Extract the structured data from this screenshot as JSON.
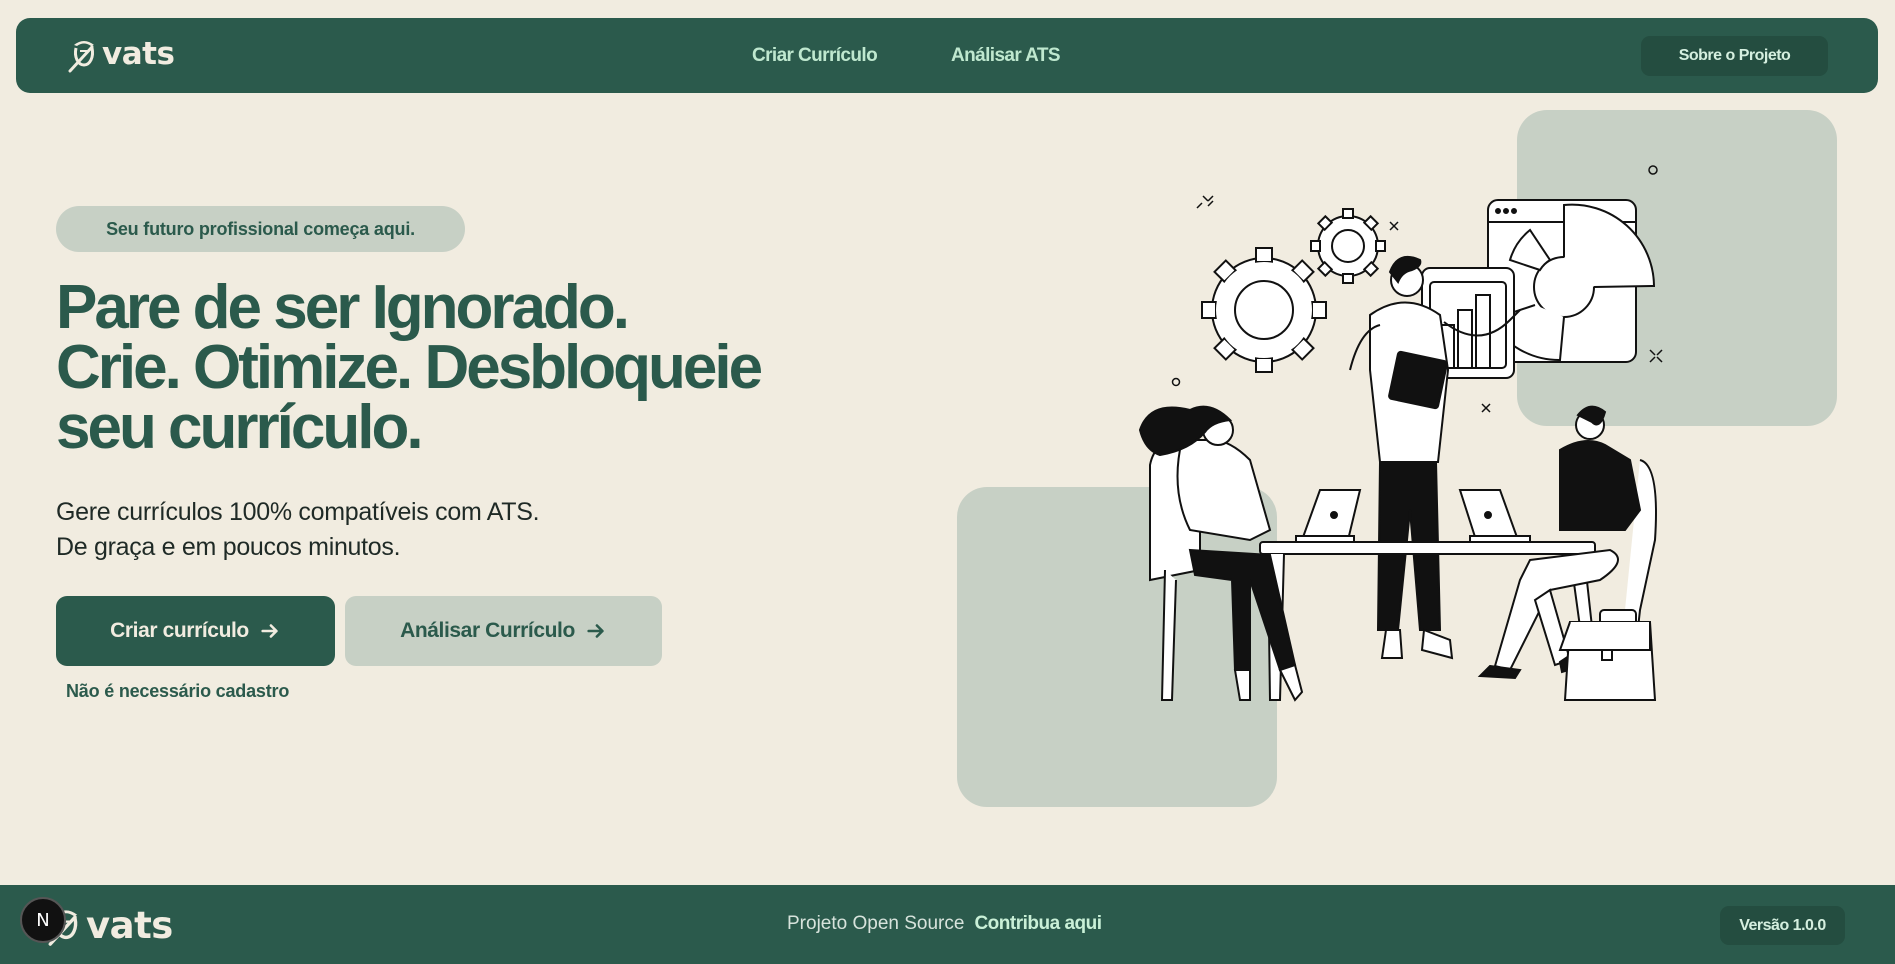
{
  "header": {
    "logo_text": "vats",
    "nav": [
      {
        "label": "Criar Currículo"
      },
      {
        "label": "Análisar ATS"
      }
    ],
    "about_label": "Sobre o Projeto"
  },
  "hero": {
    "badge": "Seu futuro profissional começa aqui.",
    "headline": [
      "Pare de ser Ignorado.",
      "Crie. Otimize. Desbloqueie",
      "seu currículo."
    ],
    "subtitle": [
      "Gere currículos 100% compatíveis com ATS.",
      "De graça e em poucos minutos."
    ],
    "primary_button": "Criar currículo",
    "secondary_button": "Análisar Currículo",
    "note": "Não é necessário cadastro"
  },
  "footer": {
    "logo_text": "vats",
    "next_badge": "N",
    "open_source": "Projeto Open Source",
    "contribute": "Contribua aqui",
    "version": "Versão 1.0.0"
  },
  "colors": {
    "background": "#f1ece0",
    "primary": "#2b5a4c",
    "secondary": "#c7d0c5",
    "nav_text": "#bfe8cf"
  },
  "icons": [
    "logo-mark-icon",
    "arrow-right-icon",
    "gear-icon",
    "nextjs-icon"
  ]
}
